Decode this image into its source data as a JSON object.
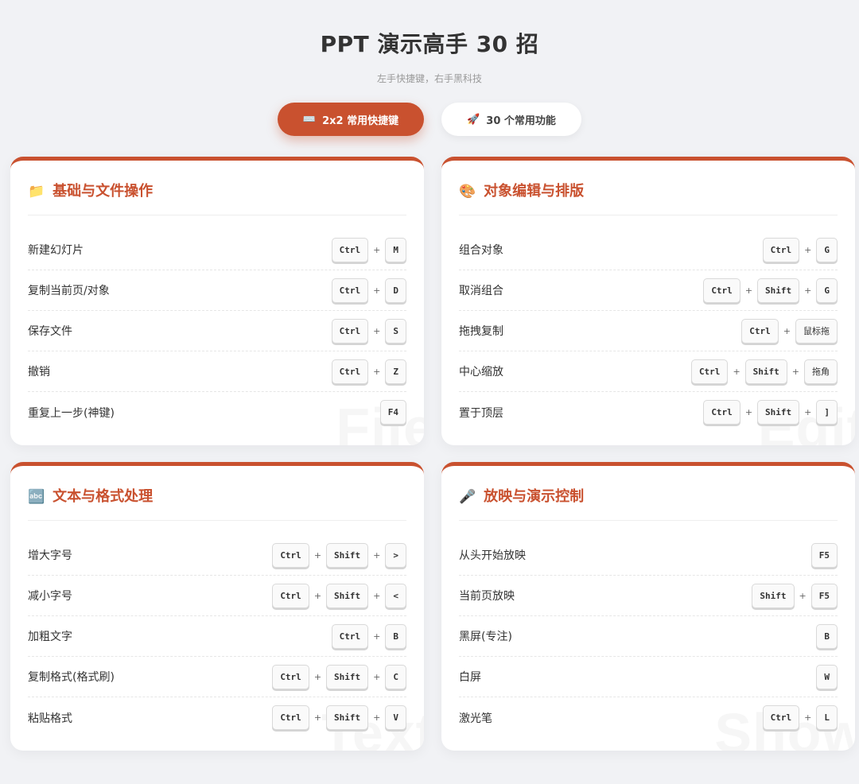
{
  "header": {
    "title": "PPT 演示高手 30 招",
    "subtitle": "左手快捷键，右手黑科技"
  },
  "tabs": [
    {
      "icon": "⌨️",
      "label": "2x2 常用快捷键",
      "active": true
    },
    {
      "icon": "🚀",
      "label": "30 个常用功能",
      "active": false
    }
  ],
  "colors": {
    "accent": "#c9512f",
    "background": "#f1f2f5"
  },
  "cards": [
    {
      "icon": "📁",
      "title": "基础与文件操作",
      "watermark": "File",
      "rows": [
        {
          "label": "新建幻灯片",
          "keys": [
            "Ctrl",
            "M"
          ]
        },
        {
          "label": "复制当前页/对象",
          "keys": [
            "Ctrl",
            "D"
          ]
        },
        {
          "label": "保存文件",
          "keys": [
            "Ctrl",
            "S"
          ]
        },
        {
          "label": "撤销",
          "keys": [
            "Ctrl",
            "Z"
          ]
        },
        {
          "label": "重复上一步(神键)",
          "keys": [
            "F4"
          ]
        }
      ]
    },
    {
      "icon": "🎨",
      "title": "对象编辑与排版",
      "watermark": "Edit",
      "rows": [
        {
          "label": "组合对象",
          "keys": [
            "Ctrl",
            "G"
          ]
        },
        {
          "label": "取消组合",
          "keys": [
            "Ctrl",
            "Shift",
            "G"
          ]
        },
        {
          "label": "拖拽复制",
          "keys": [
            "Ctrl",
            "鼠标拖"
          ]
        },
        {
          "label": "中心缩放",
          "keys": [
            "Ctrl",
            "Shift",
            "拖角"
          ]
        },
        {
          "label": "置于顶层",
          "keys": [
            "Ctrl",
            "Shift",
            "]"
          ]
        }
      ]
    },
    {
      "icon": "🔤",
      "title": "文本与格式处理",
      "watermark": "Text",
      "rows": [
        {
          "label": "增大字号",
          "keys": [
            "Ctrl",
            "Shift",
            ">"
          ]
        },
        {
          "label": "减小字号",
          "keys": [
            "Ctrl",
            "Shift",
            "<"
          ]
        },
        {
          "label": "加粗文字",
          "keys": [
            "Ctrl",
            "B"
          ]
        },
        {
          "label": "复制格式(格式刷)",
          "keys": [
            "Ctrl",
            "Shift",
            "C"
          ]
        },
        {
          "label": "粘贴格式",
          "keys": [
            "Ctrl",
            "Shift",
            "V"
          ]
        }
      ]
    },
    {
      "icon": "🎤",
      "title": "放映与演示控制",
      "watermark": "Show",
      "rows": [
        {
          "label": "从头开始放映",
          "keys": [
            "F5"
          ]
        },
        {
          "label": "当前页放映",
          "keys": [
            "Shift",
            "F5"
          ]
        },
        {
          "label": "黑屏(专注)",
          "keys": [
            "B"
          ]
        },
        {
          "label": "白屏",
          "keys": [
            "W"
          ]
        },
        {
          "label": "激光笔",
          "keys": [
            "Ctrl",
            "L"
          ]
        }
      ]
    }
  ]
}
